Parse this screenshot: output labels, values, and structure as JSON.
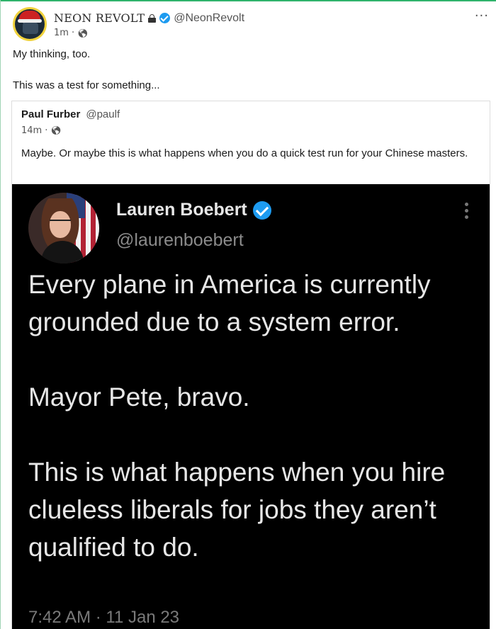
{
  "post": {
    "author": {
      "display_name": "NEON REVOLT",
      "handle": "@NeonRevolt",
      "locked": true,
      "verified": true
    },
    "time": "1m",
    "separator": "·",
    "visibility_icon": "globe-icon",
    "more_icon": "more-horizontal-icon",
    "paragraphs": [
      "My thinking, too.",
      "This was a test for something..."
    ]
  },
  "quote": {
    "author": {
      "display_name": "Paul Furber",
      "handle": "@paulf"
    },
    "time": "14m",
    "separator": "·",
    "visibility_icon": "globe-icon",
    "text": "Maybe. Or maybe this is what happens when you do a quick test run for your Chinese masters."
  },
  "embedded_tweet": {
    "display_name": "Lauren Boebert",
    "handle": "@laurenboebert",
    "verified": true,
    "paragraphs": [
      "Every plane in America is currently grounded due to a system error.",
      "Mayor Pete, bravo.",
      "This is what happens when you hire clueless liberals for jobs they aren’t qualified to do."
    ],
    "timestamp": "7:42 AM · 11 Jan 23"
  },
  "colors": {
    "accent_green": "#2fb36b",
    "verified_blue": "#1d9bf0",
    "tweet_background": "#000000",
    "tweet_text": "#e7e7e7"
  }
}
